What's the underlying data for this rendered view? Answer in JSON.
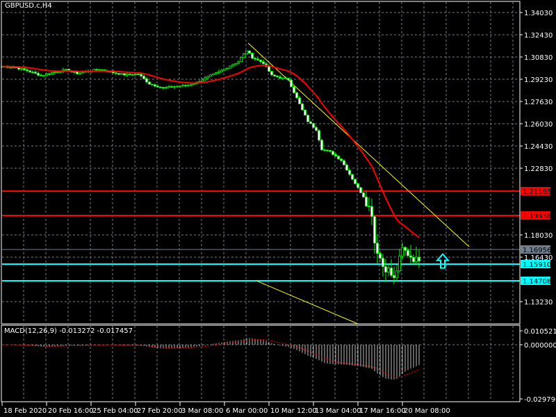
{
  "symbol_title": "GBPUSD.c,H4",
  "macd_label": "MACD(12,26,9) -0.013272 -0.017457",
  "colors": {
    "background": "#000000",
    "grid": "#6b7b8c",
    "candle": "#00ff00",
    "moving_average": "#ff0000",
    "resistance": "#ff0000",
    "support": "#00ffff",
    "trendline": "#ffff00",
    "current_price": "#708090",
    "macd_hist": "#c0c0c0",
    "macd_signal": "#ff0000"
  },
  "price_axis": {
    "ticks": [
      "1.34030",
      "1.32430",
      "1.30830",
      "1.29230",
      "1.27630",
      "1.26030",
      "1.24430",
      "1.22830",
      "1.18030",
      "1.16430",
      "1.13230"
    ],
    "tick_values": [
      1.3403,
      1.3243,
      1.3083,
      1.2923,
      1.2763,
      1.2603,
      1.2443,
      1.2283,
      1.1803,
      1.1643,
      1.1323
    ]
  },
  "horizontal_levels": [
    {
      "label": "1.21165",
      "value": 1.21165,
      "kind": "resistance"
    },
    {
      "label": "1.19438",
      "value": 1.19438,
      "kind": "resistance"
    },
    {
      "label": "1.16956",
      "value": 1.16956,
      "kind": "current_price"
    },
    {
      "label": "1.15910",
      "value": 1.1591,
      "kind": "support"
    },
    {
      "label": "1.14708",
      "value": 1.14708,
      "kind": "support"
    }
  ],
  "macd_axis": {
    "ticks": [
      "0.010521",
      "0.000000",
      "-0.029796"
    ],
    "tick_values": [
      0.010521,
      0,
      -0.029796
    ]
  },
  "time_axis": [
    "18 Feb 2020",
    "20 Feb 16:00",
    "25 Feb 04:00",
    "27 Feb 20:00",
    "3 Mar 08:00",
    "6 Mar 00:00",
    "10 Mar 12:00",
    "13 Mar 04:00",
    "17 Mar 16:00",
    "20 Mar 08:00"
  ],
  "price_path": [
    [
      0,
      1.3015
    ],
    [
      4,
      1.301
    ],
    [
      9,
      1.2985
    ],
    [
      14,
      1.295
    ],
    [
      19,
      1.2975
    ],
    [
      23,
      1.299
    ],
    [
      27,
      1.2965
    ],
    [
      32,
      1.2985
    ],
    [
      35,
      1.2995
    ],
    [
      39,
      1.2975
    ],
    [
      44,
      1.2955
    ],
    [
      49,
      1.296
    ],
    [
      53,
      1.289
    ],
    [
      58,
      1.286
    ],
    [
      62,
      1.287
    ],
    [
      67,
      1.288
    ],
    [
      70,
      1.29
    ],
    [
      74,
      1.294
    ],
    [
      78,
      1.2975
    ],
    [
      82,
      1.302
    ],
    [
      85,
      1.305
    ],
    [
      88,
      1.313
    ],
    [
      90,
      1.308
    ],
    [
      94,
      1.304
    ],
    [
      97,
      1.295
    ],
    [
      99,
      1.294
    ],
    [
      103,
      1.292
    ],
    [
      105,
      1.283
    ],
    [
      108,
      1.27
    ],
    [
      110,
      1.262
    ],
    [
      113,
      1.256
    ],
    [
      115,
      1.242
    ],
    [
      118,
      1.24
    ],
    [
      122,
      1.234
    ],
    [
      125,
      1.224
    ],
    [
      128,
      1.214
    ],
    [
      130,
      1.208
    ],
    [
      133,
      1.196
    ],
    [
      134,
      1.175
    ],
    [
      137,
      1.158
    ],
    [
      139,
      1.155
    ],
    [
      141,
      1.148
    ],
    [
      144,
      1.17
    ],
    [
      147,
      1.165
    ],
    [
      149,
      1.162
    ],
    [
      150,
      1.164
    ]
  ],
  "trendlines": [
    {
      "from": [
        88.5,
        1.3183
      ],
      "to": [
        168,
        1.1718
      ]
    },
    {
      "from": [
        91.75,
        1.14708
      ],
      "to": [
        128,
        1.1163
      ]
    }
  ],
  "signal_arrow": {
    "type": "buy",
    "bar": 158.5,
    "price": 1.1605
  }
}
